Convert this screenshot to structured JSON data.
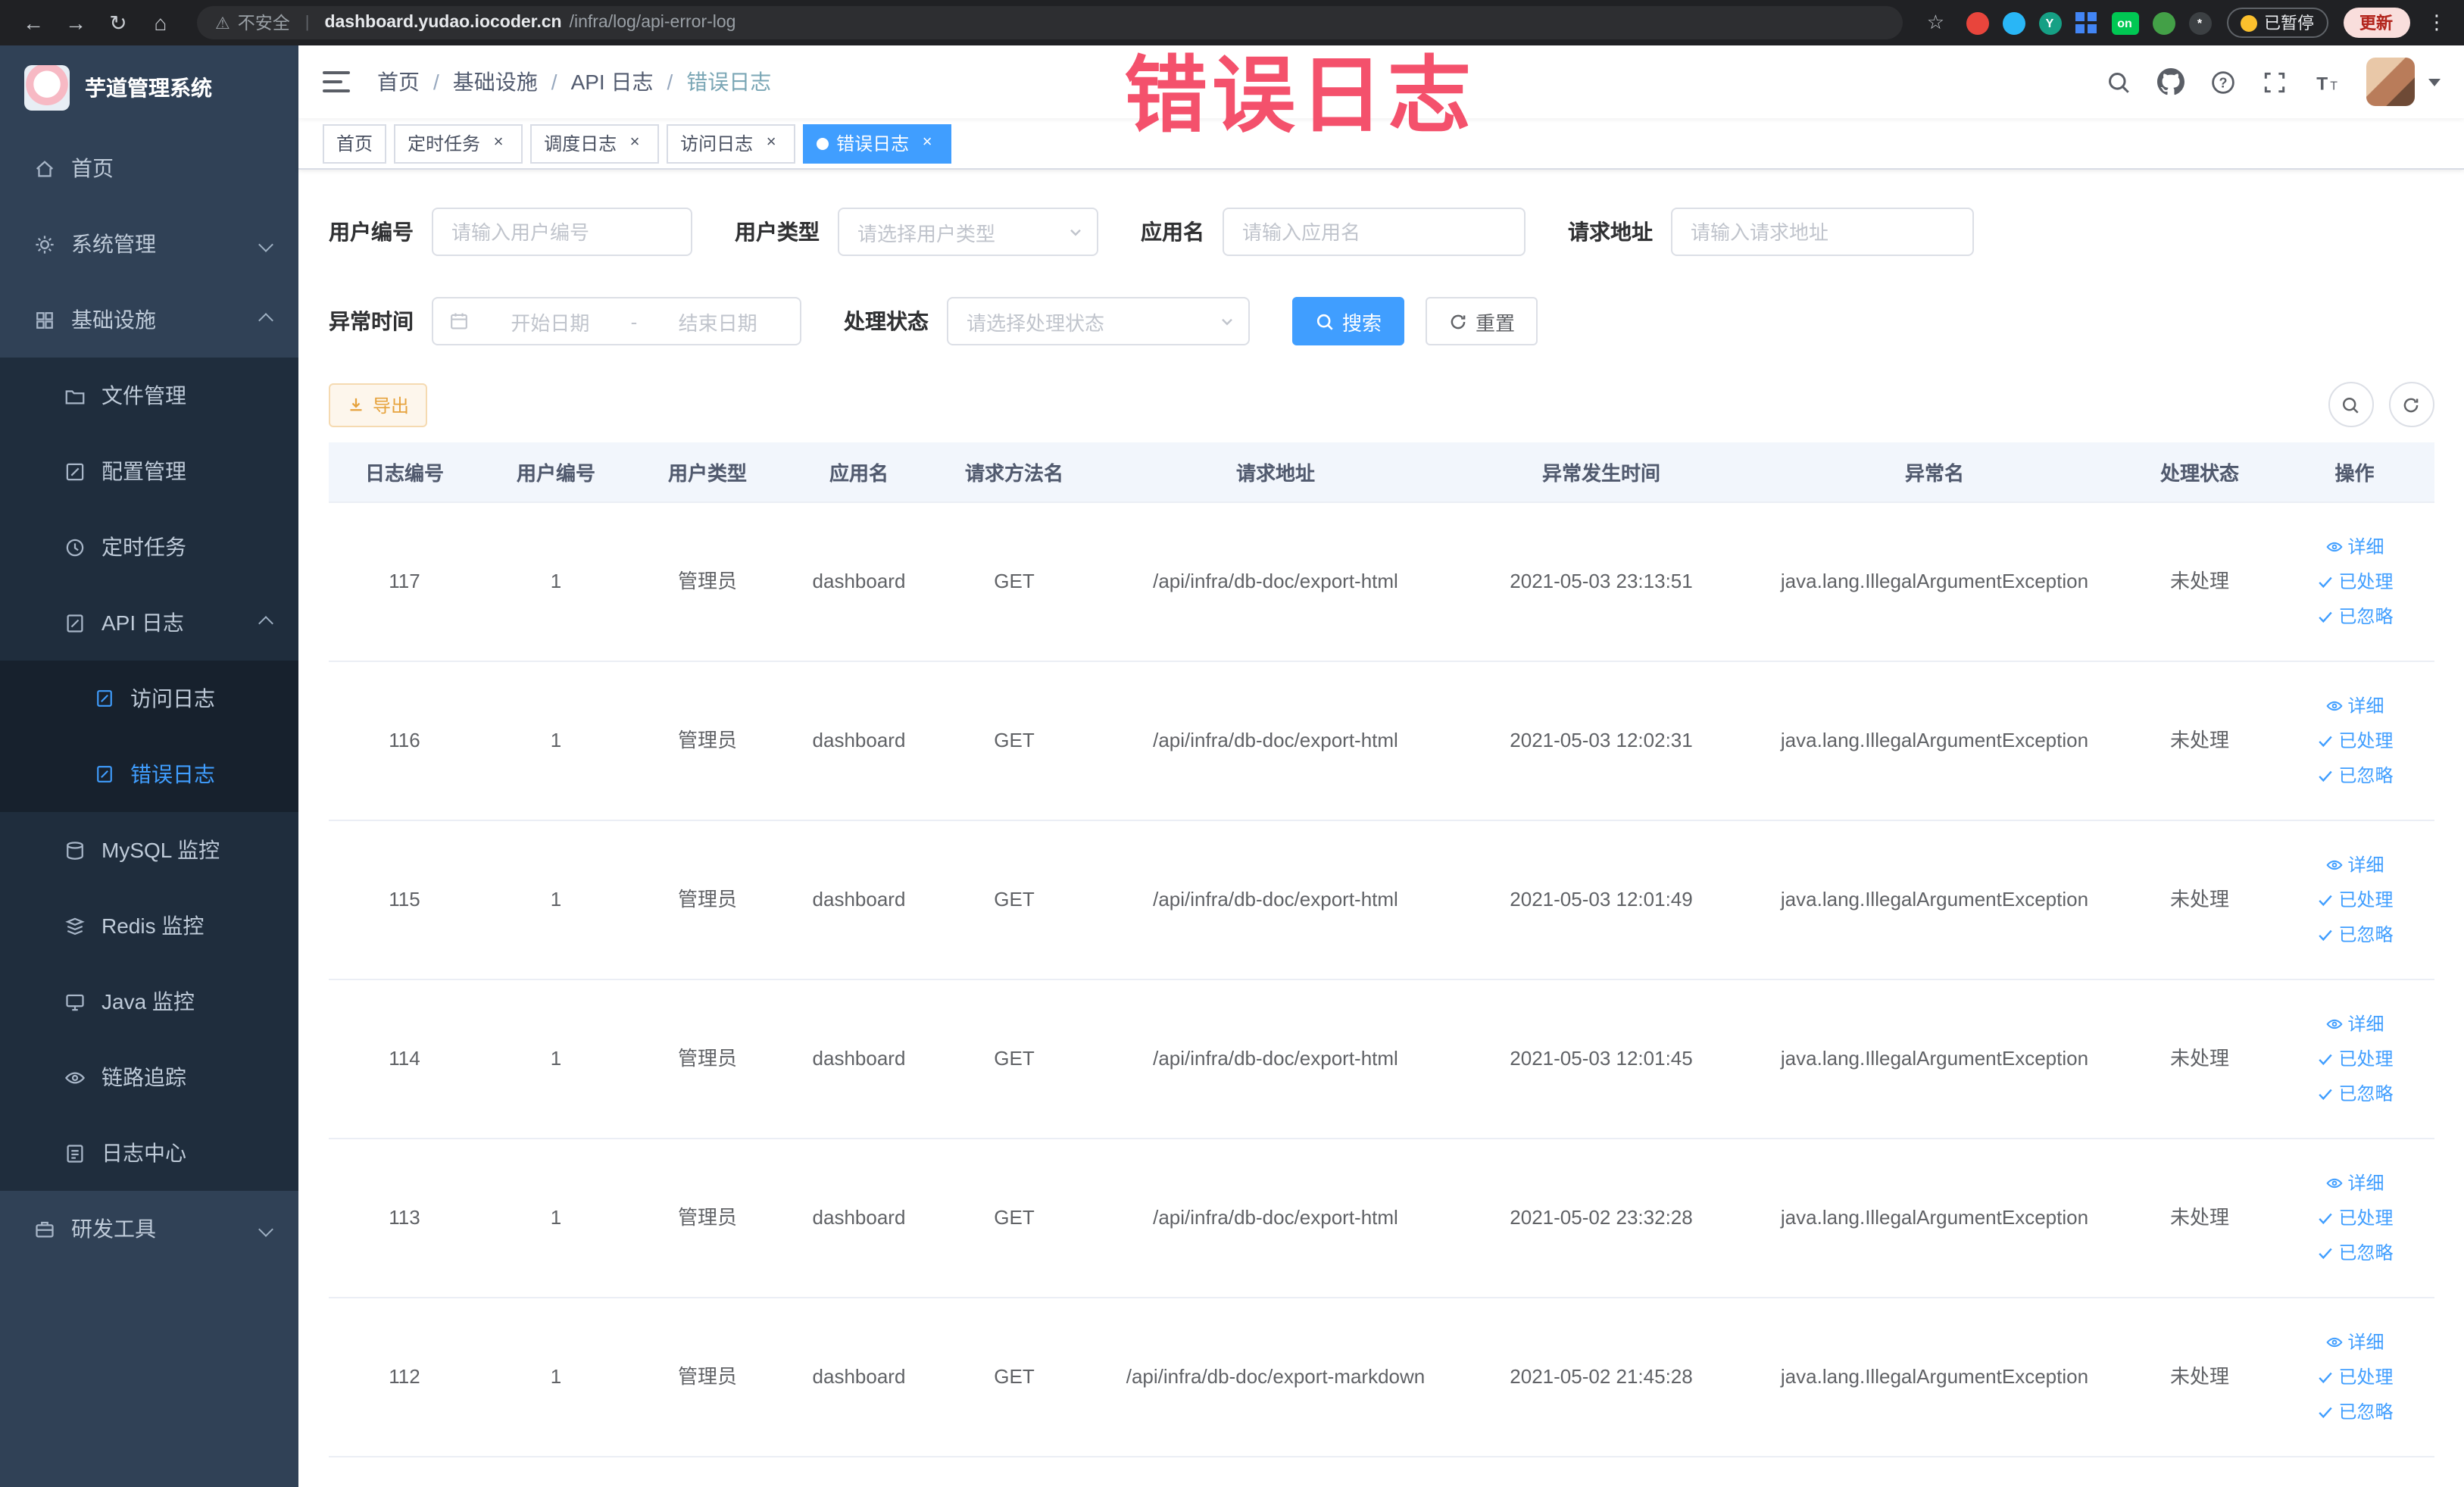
{
  "browser": {
    "glyphs": {
      "back": "←",
      "forward": "→",
      "reload": "↻",
      "home": "⌂",
      "star": "☆",
      "warning": "⚠",
      "kebab": "⋮"
    },
    "security_label": "不安全",
    "url_domain": "dashboard.yudao.iocoder.cn",
    "url_path": "/infra/log/api-error-log",
    "ext_on_label": "on",
    "paused_label": "已暂停",
    "update_label": "更新"
  },
  "sidebar": {
    "app_title": "芋道管理系统",
    "items": [
      {
        "label": "首页"
      },
      {
        "label": "系统管理"
      },
      {
        "label": "基础设施"
      },
      {
        "label": "文件管理"
      },
      {
        "label": "配置管理"
      },
      {
        "label": "定时任务"
      },
      {
        "label": "API 日志"
      },
      {
        "label": "访问日志"
      },
      {
        "label": "错误日志",
        "active": true
      },
      {
        "label": "MySQL 监控"
      },
      {
        "label": "Redis 监控"
      },
      {
        "label": "Java 监控"
      },
      {
        "label": "链路追踪"
      },
      {
        "label": "日志中心"
      },
      {
        "label": "研发工具"
      }
    ]
  },
  "breadcrumb": [
    "首页",
    "基础设施",
    "API 日志",
    "错误日志"
  ],
  "watermark": "错误日志",
  "tabs": [
    {
      "label": "首页",
      "closable": false,
      "active": false
    },
    {
      "label": "定时任务",
      "closable": true,
      "active": false
    },
    {
      "label": "调度日志",
      "closable": true,
      "active": false
    },
    {
      "label": "访问日志",
      "closable": true,
      "active": false
    },
    {
      "label": "错误日志",
      "closable": true,
      "active": true
    }
  ],
  "filters": {
    "user_id_label": "用户编号",
    "user_id_placeholder": "请输入用户编号",
    "user_type_label": "用户类型",
    "user_type_placeholder": "请选择用户类型",
    "app_name_label": "应用名",
    "app_name_placeholder": "请输入应用名",
    "request_url_label": "请求地址",
    "request_url_placeholder": "请输入请求地址",
    "exception_time_label": "异常时间",
    "start_date_placeholder": "开始日期",
    "range_separator": "-",
    "end_date_placeholder": "结束日期",
    "process_status_label": "处理状态",
    "process_status_placeholder": "请选择处理状态",
    "search_button": "搜索",
    "reset_button": "重置"
  },
  "toolbar": {
    "export_label": "导出"
  },
  "table": {
    "columns": [
      "日志编号",
      "用户编号",
      "用户类型",
      "应用名",
      "请求方法名",
      "请求地址",
      "异常发生时间",
      "异常名",
      "处理状态",
      "操作"
    ],
    "actions": [
      "详细",
      "已处理",
      "已忽略"
    ],
    "rows": [
      {
        "id": "117",
        "user_id": "1",
        "user_type": "管理员",
        "app": "dashboard",
        "method": "GET",
        "url": "/api/infra/db-doc/export-html",
        "time": "2021-05-03 23:13:51",
        "exception": "java.lang.IllegalArgumentException",
        "status": "未处理"
      },
      {
        "id": "116",
        "user_id": "1",
        "user_type": "管理员",
        "app": "dashboard",
        "method": "GET",
        "url": "/api/infra/db-doc/export-html",
        "time": "2021-05-03 12:02:31",
        "exception": "java.lang.IllegalArgumentException",
        "status": "未处理"
      },
      {
        "id": "115",
        "user_id": "1",
        "user_type": "管理员",
        "app": "dashboard",
        "method": "GET",
        "url": "/api/infra/db-doc/export-html",
        "time": "2021-05-03 12:01:49",
        "exception": "java.lang.IllegalArgumentException",
        "status": "未处理"
      },
      {
        "id": "114",
        "user_id": "1",
        "user_type": "管理员",
        "app": "dashboard",
        "method": "GET",
        "url": "/api/infra/db-doc/export-html",
        "time": "2021-05-03 12:01:45",
        "exception": "java.lang.IllegalArgumentException",
        "status": "未处理"
      },
      {
        "id": "113",
        "user_id": "1",
        "user_type": "管理员",
        "app": "dashboard",
        "method": "GET",
        "url": "/api/infra/db-doc/export-html",
        "time": "2021-05-02 23:32:28",
        "exception": "java.lang.IllegalArgumentException",
        "status": "未处理"
      },
      {
        "id": "112",
        "user_id": "1",
        "user_type": "管理员",
        "app": "dashboard",
        "method": "GET",
        "url": "/api/infra/db-doc/export-markdown",
        "time": "2021-05-02 21:45:28",
        "exception": "java.lang.IllegalArgumentException",
        "status": "未处理"
      }
    ]
  },
  "colors": {
    "primary": "#409EFF",
    "sidebar_bg": "#304156",
    "submenu_bg": "#1f2d3d",
    "watermark": "#f4516c",
    "warning": "#e6a23c"
  }
}
